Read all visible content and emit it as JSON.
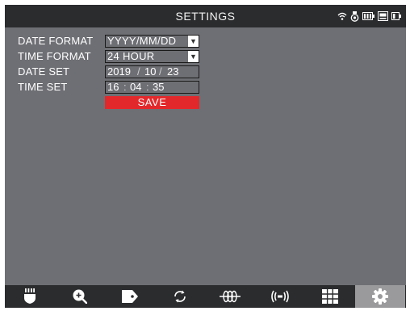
{
  "header": {
    "title": "SETTINGS",
    "status_icons": [
      "wifi-icon",
      "camera-icon",
      "battery-icon",
      "storage-icon",
      "battery-small-icon"
    ]
  },
  "settings": {
    "date_format": {
      "label": "DATE FORMAT",
      "value": "YYYY/MM/DD"
    },
    "time_format": {
      "label": "TIME FORMAT",
      "value": "24 HOUR"
    },
    "date_set": {
      "label": "DATE SET",
      "year": "2019",
      "month": "10",
      "day": "23",
      "separator": "/"
    },
    "time_set": {
      "label": "TIME SET",
      "hour": "16",
      "minute": "04",
      "second": "35",
      "separator": ":"
    },
    "save_label": "SAVE"
  },
  "toolbar": {
    "items": [
      {
        "icon": "flashlight-icon"
      },
      {
        "icon": "zoom-in-icon"
      },
      {
        "icon": "tag-icon"
      },
      {
        "icon": "rotate-icon"
      },
      {
        "icon": "coil-icon"
      },
      {
        "icon": "signal-icon"
      },
      {
        "icon": "grid-icon"
      },
      {
        "icon": "gear-icon",
        "active": true
      }
    ]
  },
  "colors": {
    "background": "#6e6f74",
    "bars": "#2b2c2e",
    "save": "#e3282b",
    "active_tab": "#9a9a9c"
  }
}
